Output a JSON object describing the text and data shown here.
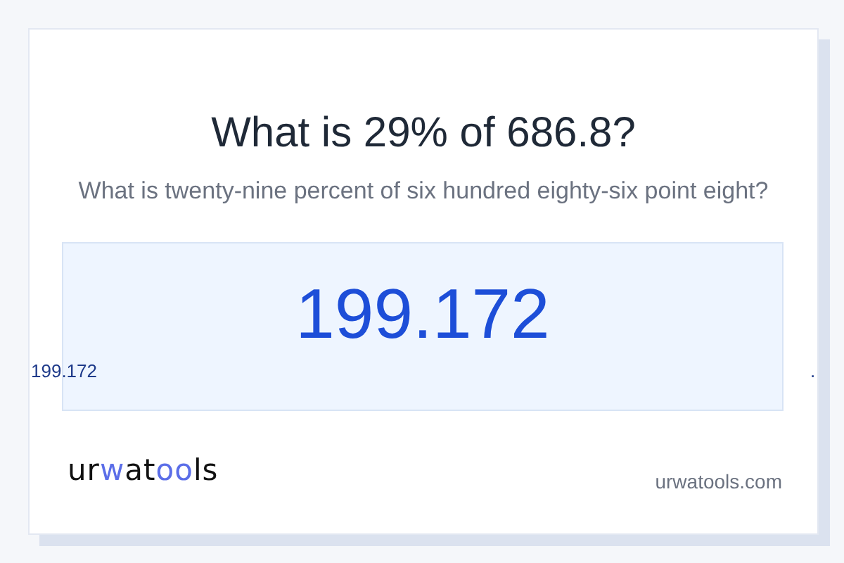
{
  "title": "What is 29% of 686.8?",
  "subtitle": "What is twenty-nine percent of six hundred eighty-six point eight?",
  "result": "199.172",
  "result_small": "199.172",
  "trailing_mark": ".",
  "logo": [
    {
      "text": "ur",
      "accent": false
    },
    {
      "text": "w",
      "accent": true
    },
    {
      "text": "at",
      "accent": false
    },
    {
      "text": "oo",
      "accent": true
    },
    {
      "text": "ls",
      "accent": false
    }
  ],
  "site": "urwatools.com"
}
